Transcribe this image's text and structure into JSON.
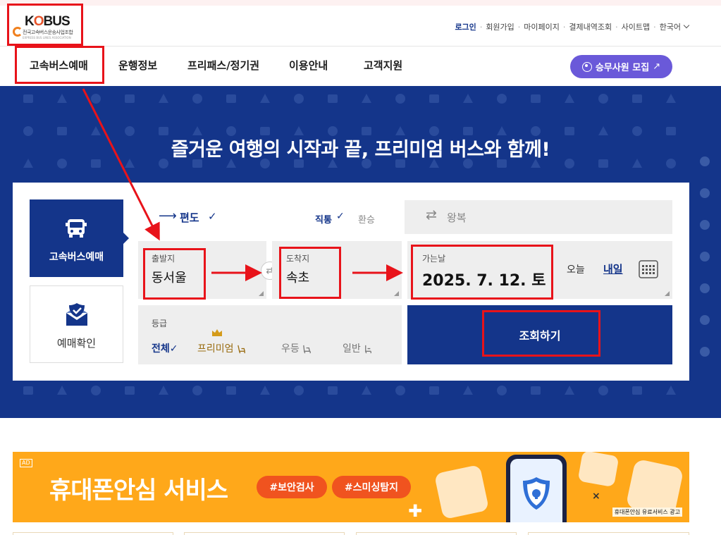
{
  "logo": {
    "word_a": "K",
    "word_o": "O",
    "word_b": "BUS",
    "subtitle": "전국고속버스운송사업조합",
    "subtitle_en": "EXPRESS BUS LINES ASSOCIATION"
  },
  "util_nav": {
    "login": "로그인",
    "signup": "회원가입",
    "mypage": "마이페이지",
    "payment": "결제내역조회",
    "sitemap": "사이트맵",
    "language": "한국어"
  },
  "gnb": {
    "items": [
      "고속버스예매",
      "운행정보",
      "프리패스/정기권",
      "이용안내",
      "고객지원"
    ]
  },
  "recruit_button": {
    "label": "승무사원 모집",
    "arrow": "↗"
  },
  "hero": {
    "title": "즐거운 여행의 시작과 끝, 프리미엄 버스와 함께!"
  },
  "side_tabs": {
    "reserve": "고속버스예매",
    "confirm": "예매확인"
  },
  "trip_type": {
    "oneway": "편도",
    "oneway_check": "✓",
    "direct": "직통",
    "direct_check": "✓",
    "transfer": "환승",
    "round": "왕복",
    "arrow": "⟶",
    "swap": "⇄"
  },
  "departure": {
    "label": "출발지",
    "value": "동서울"
  },
  "arrival": {
    "label": "도착지",
    "value": "속초"
  },
  "swap_symbol": "⇄",
  "date": {
    "label": "가는날",
    "value": "2025. 7. 12. 토",
    "today": "오늘",
    "tomorrow": "내일"
  },
  "grade": {
    "label": "등급",
    "all": "전체✓",
    "premium": "프리미엄",
    "gold": "우등",
    "normal": "일반"
  },
  "search_button": "조회하기",
  "ad": {
    "tag": "AD",
    "title": "휴대폰안심 서비스",
    "tag1": "#보안검사",
    "tag2": "#스미싱탐지",
    "note": "휴대폰안심 유료서비스 광고",
    "x": "×",
    "plus": "✚"
  },
  "colors": {
    "brand_navy": "#14358a",
    "recruit_purple": "#6a59d9",
    "ad_orange": "#ffa81a",
    "annotation_red": "#e8131a"
  }
}
